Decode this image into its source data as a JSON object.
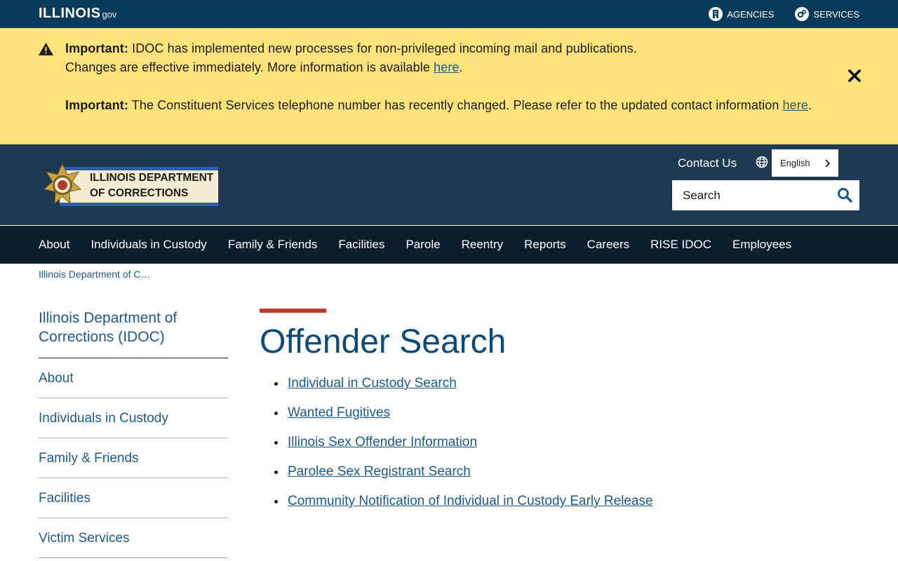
{
  "topbar": {
    "logo_word": "ILLINOIS",
    "logo_suffix": "gov",
    "agencies_label": "AGENCIES",
    "services_label": "SERVICES"
  },
  "alert": {
    "line1_bold": "Important:",
    "line1_text": " IDOC has implemented new processes for non-privileged incoming mail and publications.",
    "line2_text": "Changes are effective immediately. More information is available ",
    "line2_link": "here",
    "line2_end": ".",
    "line3_bold": "Important:",
    "line3_text": " The Constituent Services telephone number has recently changed. Please refer to the updated contact information ",
    "line3_link": "here",
    "line3_end": "."
  },
  "header": {
    "logo_line1": "ILLINOIS DEPARTMENT",
    "logo_line2": "OF CORRECTIONS",
    "contact_label": "Contact Us",
    "language": "English",
    "search_placeholder": "Search"
  },
  "nav": {
    "items": [
      "About",
      "Individuals in Custody",
      "Family & Friends",
      "Facilities",
      "Parole",
      "Reentry",
      "Reports",
      "Careers",
      "RISE IDOC",
      "Employees"
    ]
  },
  "breadcrumb": "Illinois Department of C…",
  "sidebar": {
    "title": "Illinois Department of Corrections (IDOC)",
    "items": [
      "About",
      "Individuals in Custody",
      "Family & Friends",
      "Facilities",
      "Victim Services"
    ]
  },
  "main": {
    "title": "Offender Search",
    "links": [
      "Individual in Custody Search",
      "Wanted Fugitives",
      "Illinois Sex Offender Information",
      "Parolee Sex Registrant Search",
      "Community Notification of Individual in Custody Early Release"
    ]
  },
  "colors": {
    "topbar": "#0b3b5c",
    "alert_bg": "#fde37a",
    "header_bg": "#1e3a52",
    "nav_bg": "#0c1e2c",
    "link": "#1a5a8e",
    "title_rule": "#c0392b"
  }
}
